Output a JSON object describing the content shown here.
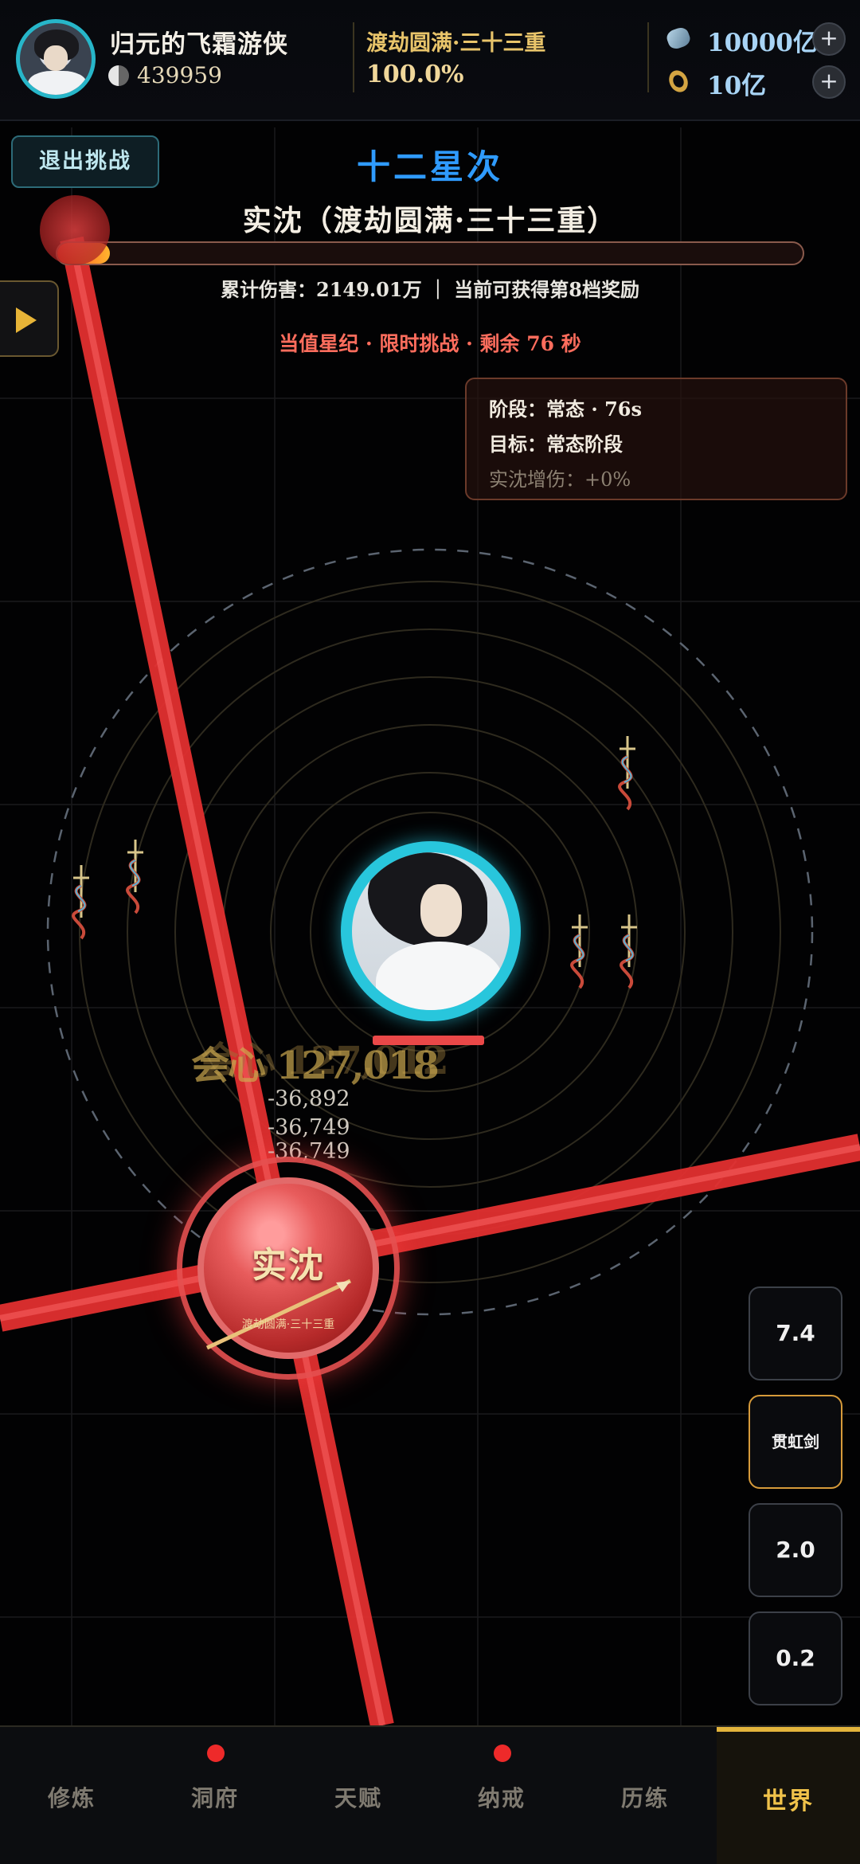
{
  "header": {
    "player_name": "归元的飞霜游侠",
    "power": "439959",
    "realm": "渡劫圆满·三十三重",
    "realm_progress": "100.0%",
    "spirit_stones": "10000亿",
    "gold": "10亿",
    "plus_label": "+"
  },
  "battle": {
    "exit_label": "退出挑战",
    "title": "十二星次",
    "boss_title": "实沈（渡劫圆满·三十三重）",
    "boss_hp_fraction": 0.07,
    "damage_summary": "累计伤害：2149.01万 ｜ 当前可获得第8档奖励",
    "event_text": "当值星纪 · 限时挑战 · 剩余 76 秒",
    "phase_panel": {
      "phase": "阶段：常态 · 76s",
      "target": "目标：常态阶段",
      "bonus": "实沈增伤：+0%"
    },
    "floating_damage": {
      "big": "会心 127,018",
      "ghost": "会心 127,012",
      "hits": [
        "-36,892",
        "-36,749",
        "-36,749"
      ]
    },
    "boss": {
      "name": "实沈",
      "realm": "渡劫圆满·三十三重"
    },
    "speed_buttons": [
      "7.4",
      "贯虹剑",
      "2.0",
      "0.2"
    ]
  },
  "nav": {
    "items": [
      {
        "label": "修炼",
        "dot": false
      },
      {
        "label": "洞府",
        "dot": true
      },
      {
        "label": "天赋",
        "dot": false
      },
      {
        "label": "纳戒",
        "dot": true
      },
      {
        "label": "历练",
        "dot": false
      },
      {
        "label": "世界",
        "dot": false
      }
    ],
    "active_index": 5
  },
  "colors": {
    "accent_blue": "#2f9bff",
    "gold": "#e3b43c",
    "laser_red": "#ff3434",
    "player_ring": "#28c6dc"
  }
}
